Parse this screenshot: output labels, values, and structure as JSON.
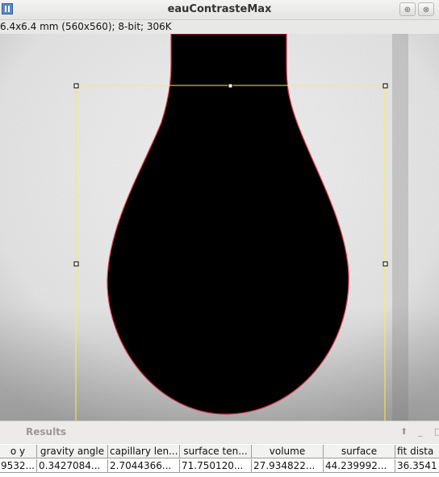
{
  "window": {
    "title": "eauContrasteMax",
    "info": "6.4x6.4 mm (560x560); 8-bit; 306K",
    "controls": [
      "maximize-icon",
      "close-icon"
    ]
  },
  "results": {
    "title": "Results",
    "controls": [
      "scroll-up-icon",
      "minimize-icon",
      "restore-icon"
    ],
    "columns": [
      "o y",
      "gravity angle",
      "capillary len...",
      "surface ten...",
      "volume",
      "surface",
      "fit dista"
    ],
    "rows": [
      [
        "9532...",
        "0.3427084...",
        "2.7044366...",
        "71.750120...",
        "27.934822...",
        "44.239992...",
        "36.3541"
      ]
    ]
  },
  "colors": {
    "selection_box": "#ffef3a",
    "drop_outline": "#d8324a",
    "drop_fill": "#000000"
  }
}
